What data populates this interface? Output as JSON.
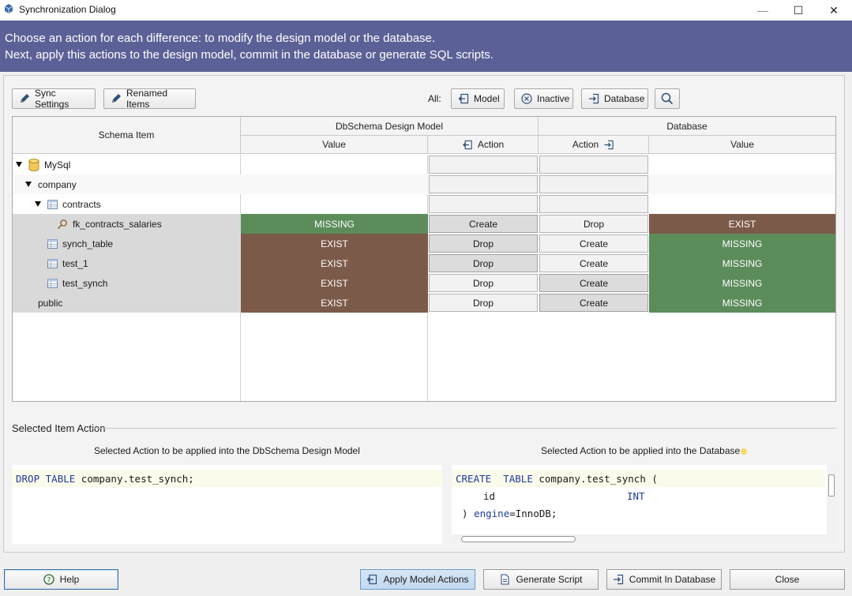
{
  "window": {
    "title": "Synchronization Dialog",
    "minimize_glyph": "—",
    "maximize_glyph": "☐",
    "close_glyph": "✕"
  },
  "banner": {
    "line1": "Choose an action for each difference: to modify the design model or the database.",
    "line2": "Next, apply this actions to the design model, commit in the database or generate SQL scripts."
  },
  "toolbar": {
    "sync_settings": "Sync Settings",
    "renamed_items": "Renamed Items",
    "all_label": "All:",
    "model": "Model",
    "inactive": "Inactive",
    "database": "Database"
  },
  "grid": {
    "headers": {
      "schema_item": "Schema Item",
      "design_model": "DbSchema Design Model",
      "database": "Database",
      "value_left": "Value",
      "action_left": "Action",
      "action_right": "Action",
      "value_right": "Value"
    },
    "rows": [
      {
        "name": "MySql",
        "indent": 0,
        "icon": "database-icon",
        "expander": true,
        "model_value": "",
        "model_action": "",
        "db_action": "",
        "db_value": "",
        "status": "none"
      },
      {
        "name": "company",
        "indent": 1,
        "icon": "",
        "expander": true,
        "model_value": "",
        "model_action": "",
        "db_action": "",
        "db_value": "",
        "status": "none"
      },
      {
        "name": "contracts",
        "indent": 2,
        "icon": "table-icon",
        "expander": true,
        "model_value": "",
        "model_action": "",
        "db_action": "",
        "db_value": "",
        "status": "none"
      },
      {
        "name": "fk_contracts_salaries",
        "indent": 3,
        "icon": "foreign-key-icon",
        "expander": false,
        "model_value": "MISSING",
        "model_action": "Create",
        "db_action": "Drop",
        "db_value": "EXIST",
        "status": "model-missing",
        "pressed": "model"
      },
      {
        "name": "synch_table",
        "indent": 2,
        "icon": "table-icon",
        "expander": false,
        "model_value": "EXIST",
        "model_action": "Drop",
        "db_action": "Create",
        "db_value": "MISSING",
        "status": "db-missing",
        "pressed": "model"
      },
      {
        "name": "test_1",
        "indent": 2,
        "icon": "table-icon",
        "expander": false,
        "model_value": "EXIST",
        "model_action": "Drop",
        "db_action": "Create",
        "db_value": "MISSING",
        "status": "db-missing",
        "pressed": "model"
      },
      {
        "name": "test_synch",
        "indent": 2,
        "icon": "table-icon",
        "expander": false,
        "model_value": "EXIST",
        "model_action": "Drop",
        "db_action": "Create",
        "db_value": "MISSING",
        "status": "db-missing",
        "pressed": "db"
      },
      {
        "name": "public",
        "indent": 1,
        "icon": "",
        "expander": false,
        "model_value": "EXIST",
        "model_action": "Drop",
        "db_action": "Create",
        "db_value": "MISSING",
        "status": "db-missing",
        "pressed": "db"
      }
    ]
  },
  "selected": {
    "section_title": "Selected Item Action",
    "model_caption": "Selected Action to be applied into the DbSchema Design Model",
    "db_caption": "Selected Action to be applied into the Database",
    "model_sql": {
      "kw1": "DROP",
      "kw2": "TABLE",
      "rest": " company.test_synch;"
    },
    "db_sql": {
      "line1_kw1": "CREATE",
      "line1_kw2": "TABLE",
      "line1_rest": " company.test_synch (",
      "line2_col": "id",
      "line2_type": "INT",
      "line3_paren": ")",
      "line3_kw": "engine",
      "line3_rest": "=InnoDB;"
    }
  },
  "footer": {
    "help": "Help",
    "apply_model": "Apply Model Actions",
    "generate_script": "Generate Script",
    "commit_db": "Commit In Database",
    "close": "Close"
  },
  "colors": {
    "banner": "#5b6196",
    "missing": "#5b8c5a",
    "exist": "#7c5a4a",
    "sql_keyword": "#1f3a9e"
  }
}
